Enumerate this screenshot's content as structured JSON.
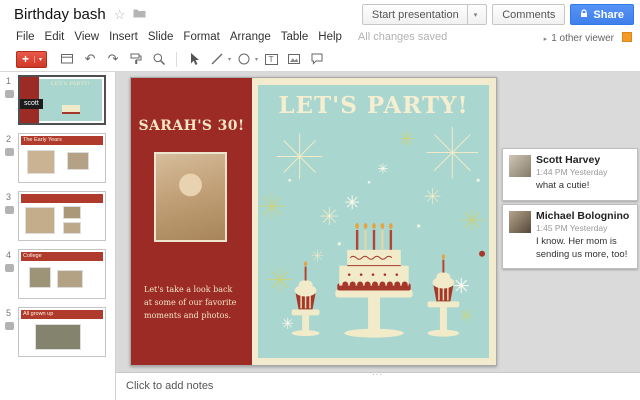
{
  "colors": {
    "accent_red": "#d03825",
    "slide_red": "#9c2b26",
    "teal": "#a9d6cf",
    "cream": "#f2ebc9",
    "share_blue": "#4d90fe",
    "presence_orange": "#f59b23"
  },
  "ui": {
    "caret_down": "▾",
    "caret_right": "▸",
    "star": "☆",
    "handle_dots": "···"
  },
  "header": {
    "doc_title": "Birthday bash",
    "start_presentation_label": "Start presentation",
    "comments_label": "Comments",
    "share_label": "Share"
  },
  "menubar": {
    "items": [
      "File",
      "Edit",
      "View",
      "Insert",
      "Slide",
      "Format",
      "Arrange",
      "Table",
      "Help"
    ],
    "status": "All changes saved",
    "viewer_label": "1 other viewer"
  },
  "toolbar": {
    "new_slide_plus": "+",
    "undo_glyph": "↶",
    "redo_glyph": "↷",
    "textbox_glyph": "T",
    "icon_names": [
      "new-slide",
      "layout",
      "undo",
      "redo",
      "paint-format",
      "zoom",
      "select-cursor",
      "line-tool",
      "shape-tool",
      "textbox-tool",
      "image-tool",
      "comment-tool"
    ]
  },
  "filmstrip": {
    "presence_tag": "scott",
    "slides": [
      {
        "num": "1",
        "title": "LET'S PARTY!"
      },
      {
        "num": "2",
        "title": "The Early Years"
      },
      {
        "num": "3",
        "title": ""
      },
      {
        "num": "4",
        "title": "College"
      },
      {
        "num": "5",
        "title": "All grown up"
      }
    ]
  },
  "slide": {
    "title": "LET'S PARTY!",
    "subtitle": "SARAH'S 30!",
    "body": "Let's take a look back at some of our favorite moments and photos."
  },
  "comments": [
    {
      "author": "Scott Harvey",
      "time": "1:44 PM Yesterday",
      "text": "what a cutie!"
    },
    {
      "author": "Michael Bolognino",
      "time": "1:45 PM Yesterday",
      "text": "I know. Her mom is sending us more, too!"
    }
  ],
  "notes": {
    "placeholder": "Click to add notes"
  }
}
